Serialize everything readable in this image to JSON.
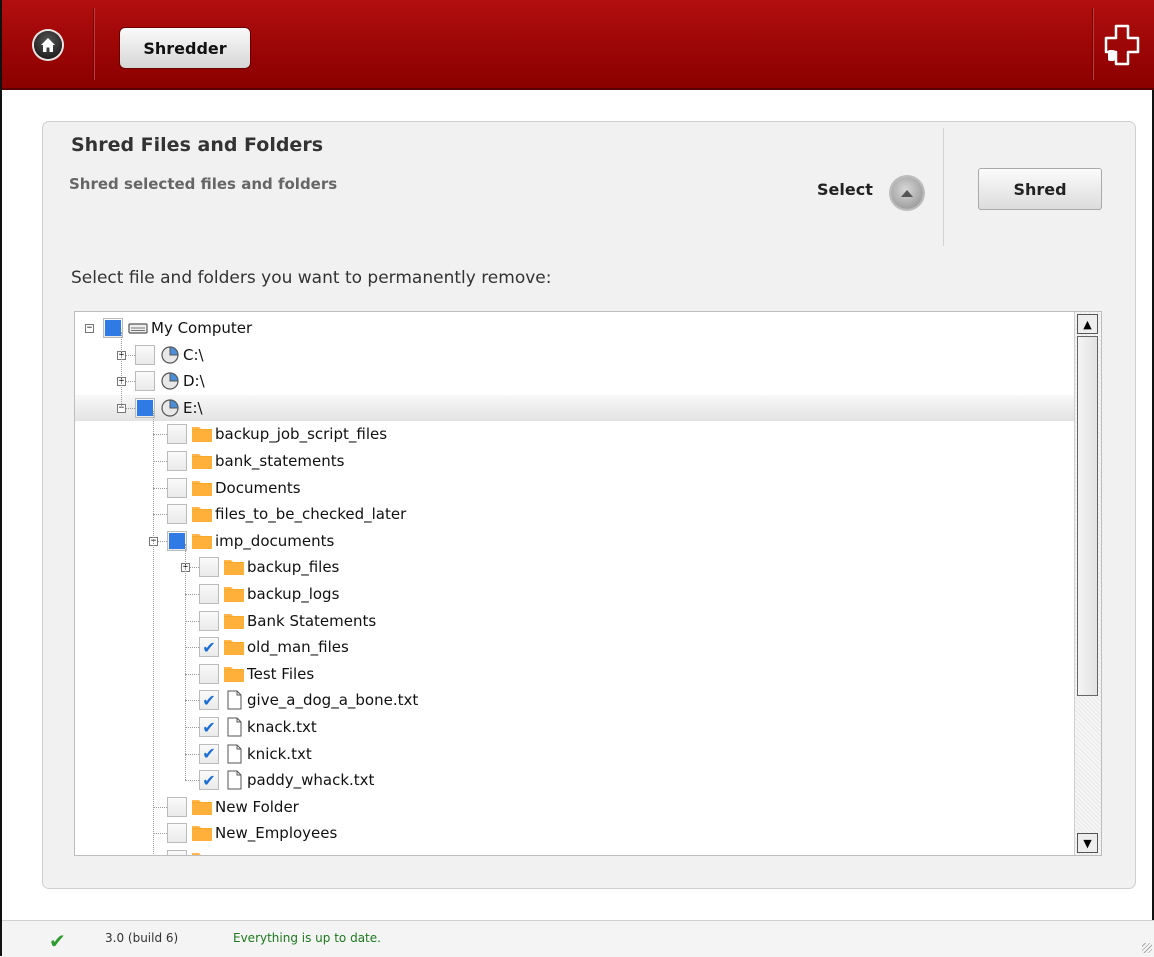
{
  "header": {
    "home_icon": "home-icon",
    "tab_label": "Shredder",
    "logo_icon": "puzzle-cross-logo-icon"
  },
  "panel": {
    "title": "Shred Files and Folders",
    "subtitle": "Shred selected files and folders",
    "select_label": "Select",
    "shred_label": "Shred",
    "instruction": "Select file and folders you want to permanently remove:"
  },
  "tree": [
    {
      "label": "My Computer",
      "level": 0,
      "icon": "computer-icon",
      "expander": "minus",
      "check": "partial"
    },
    {
      "label": "C:\\",
      "level": 1,
      "icon": "drive-icon",
      "expander": "plus",
      "check": "unchecked"
    },
    {
      "label": "D:\\",
      "level": 1,
      "icon": "drive-icon",
      "expander": "plus",
      "check": "unchecked"
    },
    {
      "label": "E:\\",
      "level": 1,
      "icon": "drive-icon",
      "expander": "minus",
      "check": "partial",
      "highlight": true
    },
    {
      "label": "backup_job_script_files",
      "level": 2,
      "icon": "folder-icon",
      "expander": "none",
      "check": "unchecked"
    },
    {
      "label": "bank_statements",
      "level": 2,
      "icon": "folder-icon",
      "expander": "none",
      "check": "unchecked"
    },
    {
      "label": "Documents",
      "level": 2,
      "icon": "folder-icon",
      "expander": "none",
      "check": "unchecked"
    },
    {
      "label": "files_to_be_checked_later",
      "level": 2,
      "icon": "folder-icon",
      "expander": "none",
      "check": "unchecked"
    },
    {
      "label": "imp_documents",
      "level": 2,
      "icon": "folder-icon",
      "expander": "minus",
      "check": "partial"
    },
    {
      "label": "backup_files",
      "level": 3,
      "icon": "folder-icon",
      "expander": "plus",
      "check": "unchecked"
    },
    {
      "label": "backup_logs",
      "level": 3,
      "icon": "folder-icon",
      "expander": "none",
      "check": "unchecked"
    },
    {
      "label": "Bank Statements",
      "level": 3,
      "icon": "folder-icon",
      "expander": "none",
      "check": "unchecked"
    },
    {
      "label": "old_man_files",
      "level": 3,
      "icon": "folder-icon",
      "expander": "none",
      "check": "checked"
    },
    {
      "label": "Test Files",
      "level": 3,
      "icon": "folder-icon",
      "expander": "none",
      "check": "unchecked"
    },
    {
      "label": "give_a_dog_a_bone.txt",
      "level": 3,
      "icon": "file-icon",
      "expander": "none",
      "check": "checked"
    },
    {
      "label": "knack.txt",
      "level": 3,
      "icon": "file-icon",
      "expander": "none",
      "check": "checked"
    },
    {
      "label": "knick.txt",
      "level": 3,
      "icon": "file-icon",
      "expander": "none",
      "check": "checked"
    },
    {
      "label": "paddy_whack.txt",
      "level": 3,
      "icon": "file-icon",
      "expander": "none",
      "check": "checked"
    },
    {
      "label": "New Folder",
      "level": 2,
      "icon": "folder-icon",
      "expander": "none",
      "check": "unchecked"
    },
    {
      "label": "New_Employees",
      "level": 2,
      "icon": "folder-icon",
      "expander": "none",
      "check": "unchecked"
    },
    {
      "label": "",
      "level": 2,
      "icon": "folder-icon",
      "expander": "none",
      "check": "unchecked"
    }
  ],
  "status": {
    "icon": "checkmark-icon",
    "version": "3.0 (build 6)",
    "message": "Everything is up to date."
  },
  "colors": {
    "header_red": "#9a0505",
    "accent_blue": "#2f7ae5",
    "status_green": "#1d7a1d"
  }
}
